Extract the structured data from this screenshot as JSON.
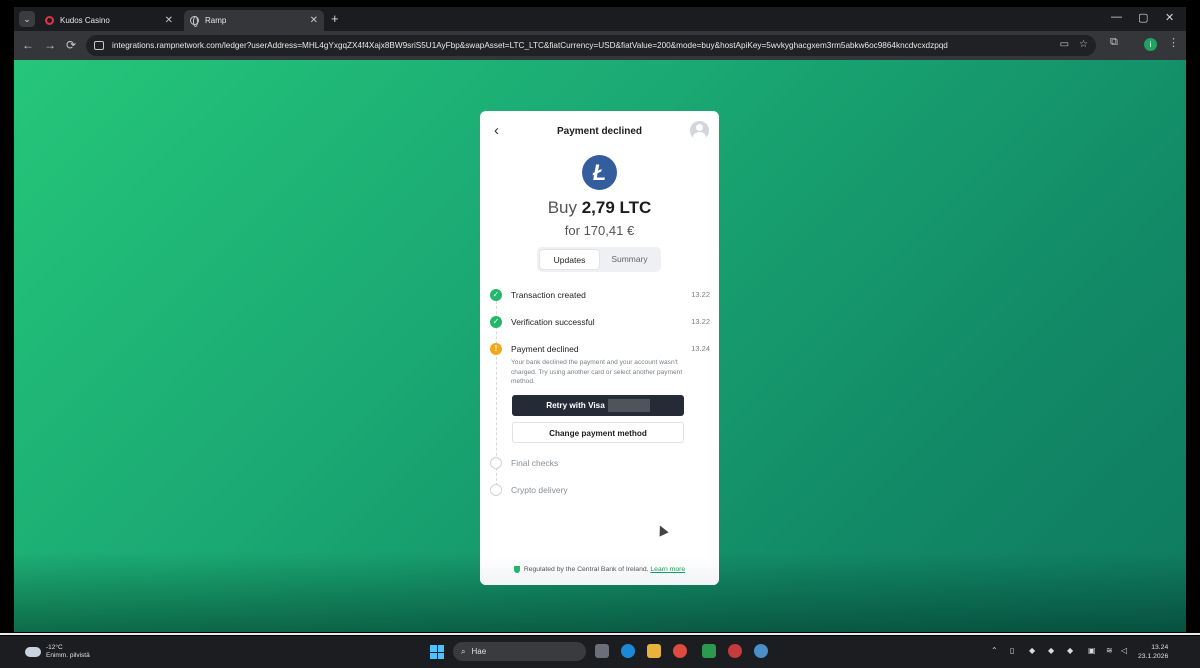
{
  "browser": {
    "tabs": [
      {
        "title": "Kudos Casino",
        "close": "✕"
      },
      {
        "title": "Ramp",
        "close": "✕"
      }
    ],
    "new_tab": "+",
    "window_controls": {
      "minimize": "—",
      "maximize": "▢",
      "close": "✕"
    },
    "nav": {
      "back": "←",
      "forward": "→",
      "reload": "⟳"
    },
    "url": "integrations.rampnetwork.com/ledger?userAddress=MHL4gYxgqZX4f4Xajx8BW9sriS5U1AyFbp&swapAsset=LTC_LTC&fiatCurrency=USD&fiatValue=200&mode=buy&hostApiKey=5wvkyghacgxem3rm5abkw6oc9864kncdvcxdzpqd",
    "profile_initial": "i"
  },
  "widget": {
    "back_icon": "‹",
    "title": "Payment declined",
    "coin_symbol": "Ł",
    "buy_prefix": "Buy",
    "buy_amount": "2,79 LTC",
    "for_text": "for 170,41 €",
    "tabs": [
      "Updates",
      "Summary"
    ],
    "steps": [
      {
        "label": "Transaction created",
        "time": "13.22",
        "status": "done"
      },
      {
        "label": "Verification successful",
        "time": "13.22",
        "status": "done"
      },
      {
        "label": "Payment declined",
        "time": "13.24",
        "status": "warning",
        "description": "Your bank declined the payment and your account wasn't charged. Try using another card or select another payment method."
      },
      {
        "label": "Final checks",
        "time": "",
        "status": "pending"
      },
      {
        "label": "Crypto delivery",
        "time": "",
        "status": "pending"
      }
    ],
    "retry_button": "Retry with Visa",
    "change_button": "Change payment method",
    "footer_text": "Regulated by the Central Bank of Ireland.",
    "footer_link": "Learn more"
  },
  "taskbar": {
    "temperature": "-12°C",
    "weather_desc": "Enimm. pilvistä",
    "search_placeholder": "Hae",
    "time": "13.24",
    "date": "23.1.2026"
  },
  "colors": {
    "accent_green": "#22b86b",
    "warning": "#f0a81c",
    "ltc_blue": "#345d9d",
    "dark_button": "#252b36"
  }
}
